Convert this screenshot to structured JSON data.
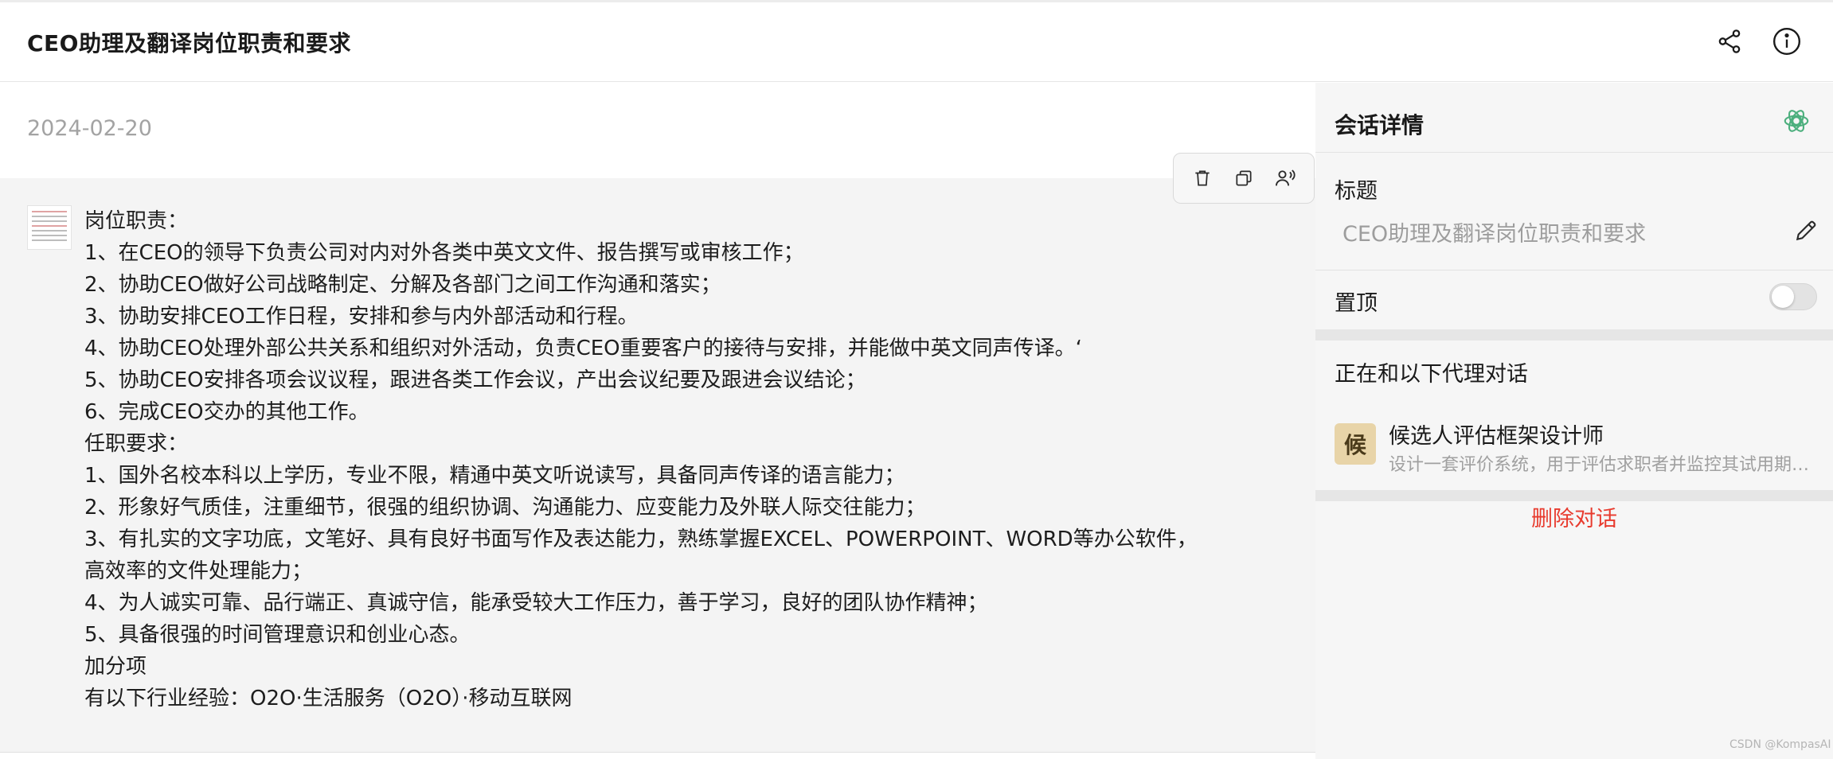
{
  "header": {
    "title": "CEO助理及翻译岗位职责和要求",
    "share_icon": "share-icon",
    "info_icon": "info-icon"
  },
  "conversation": {
    "date": "2024-02-20",
    "toolbar": [
      "trash-icon",
      "copy-icon",
      "read-aloud-icon"
    ],
    "message_lines": [
      "岗位职责：",
      "1、在CEO的领导下负责公司对内对外各类中英文文件、报告撰写或审核工作；",
      "2、协助CEO做好公司战略制定、分解及各部门之间工作沟通和落实；",
      "3、协助安排CEO工作日程，安排和参与内外部活动和行程。",
      "4、协助CEO处理外部公共关系和组织对外活动，负责CEO重要客户的接待与安排，并能做中英文同声传译。‘",
      "5、协助CEO安排各项会议议程，跟进各类工作会议，产出会议纪要及跟进会议结论；",
      "6、完成CEO交办的其他工作。",
      "任职要求：",
      "1、国外名校本科以上学历，专业不限，精通中英文听说读写，具备同声传译的语言能力；",
      "2、形象好气质佳，注重细节，很强的组织协调、沟通能力、应变能力及外联人际交往能力；",
      "3、有扎实的文字功底，文笔好、具有良好书面写作及表达能力，熟练掌握EXCEL、POWERPOINT、WORD等办公软件，",
      "高效率的文件处理能力；",
      "4、为人诚实可靠、品行端正、真诚守信，能承受较大工作压力，善于学习，良好的团队协作精神；",
      "5、具备很强的时间管理意识和创业心态。",
      "加分项",
      "有以下行业经验：O2O·生活服务（O2O）·移动互联网"
    ]
  },
  "details": {
    "panel_title": "会话详情",
    "title_label": "标题",
    "title_value": "CEO助理及翻译岗位职责和要求",
    "pin_label": "置顶",
    "pin_enabled": false,
    "agent_section_label": "正在和以下代理对话",
    "agent": {
      "avatar_char": "候",
      "avatar_color": "#e8d4a8",
      "name": "候选人评估框架设计师",
      "description": "设计一套评价系统，用于评估求职者并监控其试用期表现"
    },
    "delete_label": "删除对话",
    "delete_color": "#e83b2e"
  },
  "watermark": "CSDN @KompasAI"
}
